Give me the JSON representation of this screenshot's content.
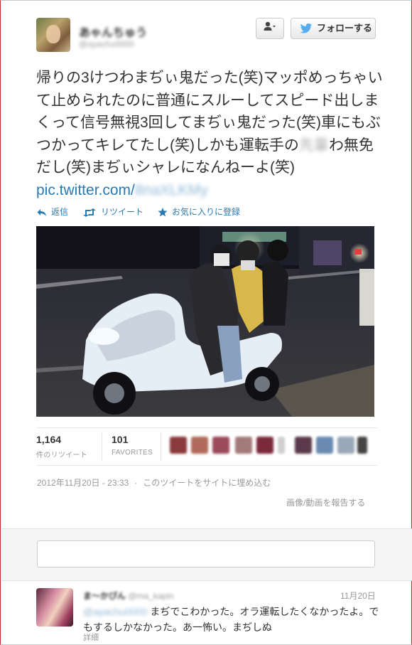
{
  "header": {
    "user_name": "あゃんちゅう",
    "user_handle": "@ayachu0000",
    "follow_label": "フォローする",
    "user_menu_icon": "user-icon"
  },
  "tweet": {
    "text_main": "帰りの3けつわまぢぃ鬼だった(笑)マッポめっちゃいて止められたのに普通にスルーしてスピード出しまくって信号無視3回してまぢぃ鬼だった(笑)車にもぶつかってキレてたし(笑)しかも運転手の",
    "text_hidden_name": "先輩",
    "text_after": "わ無免だし(笑)まぢぃシャレになんねーよ(笑) ",
    "link_prefix": "pic.twitter.com/",
    "link_hidden": "8naXLKMy"
  },
  "actions": {
    "reply": "返信",
    "retweet": "リツイート",
    "favorite": "お気に入りに登録"
  },
  "stats": {
    "retweets_count": "1,164",
    "retweets_label": "件のリツイート",
    "favorites_count": "101",
    "favorites_label": "FAVORITES"
  },
  "meta": {
    "timestamp": "2012年11月20日 - 23:33",
    "embed": "このツイートをサイトに埋め込む",
    "report": "画像/動画を報告する"
  },
  "reply_tweet": {
    "name": "ま～かぴん",
    "handle": "@ma_kapin",
    "date": "11月20日",
    "mention": "@ayachu0000",
    "text": "まぢでこわかった。オラ運転したくなかったよ。でもするしかなかった。あ一怖い。まぢしぬ",
    "detail": "詳細"
  },
  "colors": {
    "link": "#2a7ab0",
    "twitter_bird": "#55acee",
    "frame_accent": "#c62f2f"
  }
}
